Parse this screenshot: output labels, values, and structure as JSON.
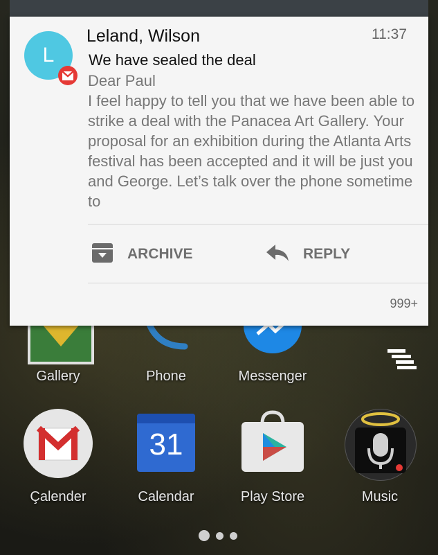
{
  "notification": {
    "avatar_letter": "L",
    "sender": "Leland, Wilson",
    "time": "11:37",
    "subject": "We have sealed the deal",
    "greeting": "Dear Paul",
    "body": "I feel happy to tell you that we have been able to strike a deal with the Panacea Art Gallery. Your proposal for an exhibition during the Atlanta Arts festival has been accepted and it will be just you and George. Let’s talk over the phone sometime to",
    "actions": {
      "archive_label": "ARCHIVE",
      "archive_icon": "archive-icon",
      "reply_label": "REPLY",
      "reply_icon": "reply-icon"
    },
    "count": "999+",
    "badge_icon": "gmail-icon"
  },
  "apps": {
    "row1": [
      {
        "label": "Gallery",
        "icon": "gallery-icon"
      },
      {
        "label": "Phone",
        "icon": "phone-icon"
      },
      {
        "label": "Messenger",
        "icon": "messenger-icon"
      }
    ],
    "row2": [
      {
        "label": "Çalender",
        "icon": "gmail-icon"
      },
      {
        "label": "Calendar",
        "icon": "calendar-icon",
        "text": "31"
      },
      {
        "label": "Play Store",
        "icon": "play-store-icon"
      },
      {
        "label": "Music",
        "icon": "microphone-icon"
      }
    ]
  },
  "home": {
    "menu_icon": "stacked-bars-icon",
    "page_indicator": {
      "pages": 3,
      "current": 1
    }
  },
  "colors": {
    "avatar": "#4fc8e2",
    "badge": "#e53935",
    "card": "#f5f5f5"
  }
}
